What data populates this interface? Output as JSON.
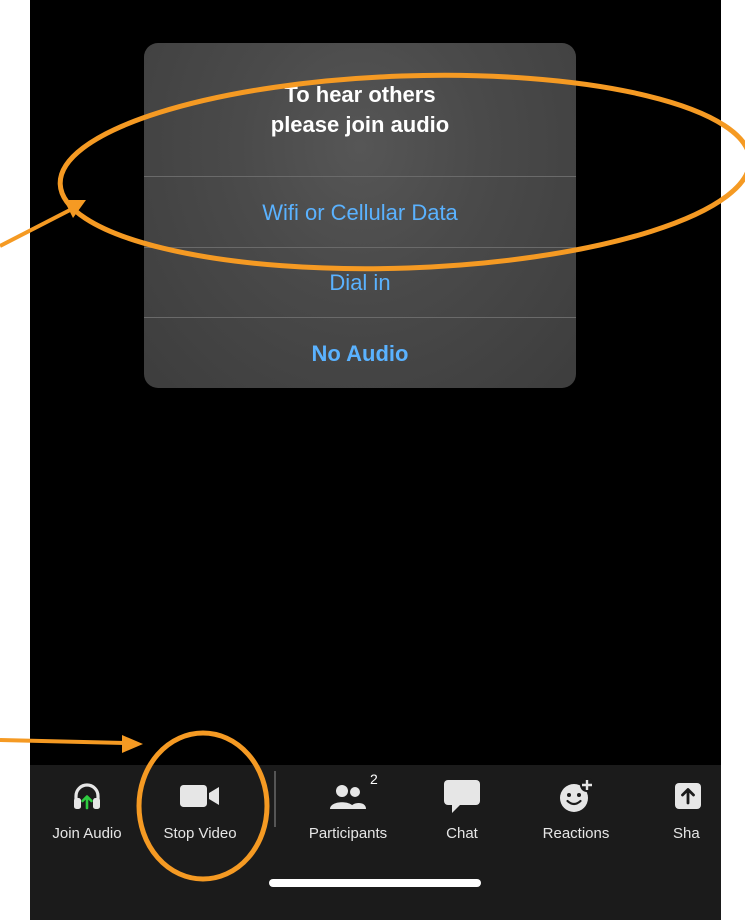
{
  "dialog": {
    "title_line1": "To hear others",
    "title_line2": "please join audio",
    "options": [
      {
        "label": "Wifi or Cellular Data"
      },
      {
        "label": "Dial in"
      },
      {
        "label": "No Audio"
      }
    ]
  },
  "toolbar": {
    "items": [
      {
        "label": "Join Audio",
        "icon": "headphones-icon"
      },
      {
        "label": "Stop Video",
        "icon": "video-camera-icon"
      },
      {
        "label": "Participants",
        "icon": "participants-icon",
        "badge": "2"
      },
      {
        "label": "Chat",
        "icon": "chat-bubble-icon"
      },
      {
        "label": "Reactions",
        "icon": "smiley-plus-icon"
      },
      {
        "label": "Sha",
        "icon": "share-icon"
      }
    ]
  },
  "colors": {
    "accent_blue": "#5ab2ff",
    "annotation_orange": "#f59a23",
    "join_audio_arrow": "#2ecc40"
  }
}
